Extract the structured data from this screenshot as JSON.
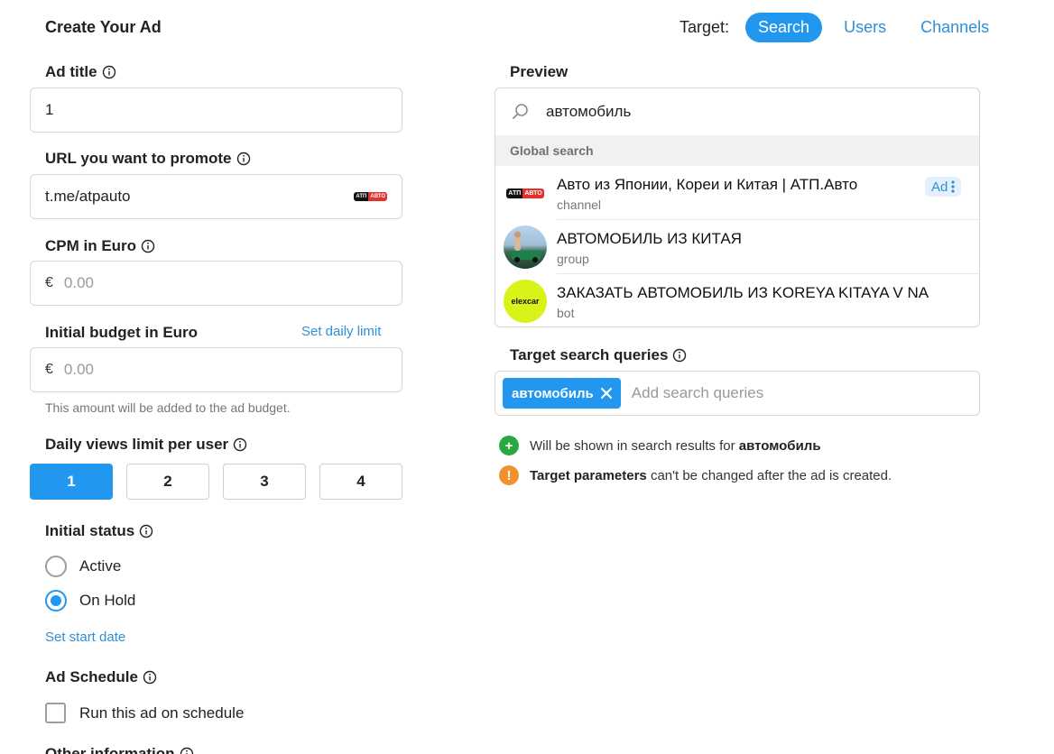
{
  "page": {
    "title": "Create Your Ad"
  },
  "target": {
    "label": "Target:",
    "tabs": [
      "Search",
      "Users",
      "Channels"
    ],
    "active": "Search"
  },
  "form": {
    "ad_title": {
      "label": "Ad title",
      "value": "1"
    },
    "url": {
      "label": "URL you want to promote",
      "value": "t.me/atpauto"
    },
    "cpm": {
      "label": "CPM in Euro",
      "prefix": "€",
      "placeholder": "0.00"
    },
    "budget": {
      "label": "Initial budget in Euro",
      "link": "Set daily limit",
      "prefix": "€",
      "placeholder": "0.00",
      "hint": "This amount will be added to the ad budget."
    },
    "views_limit": {
      "label": "Daily views limit per user",
      "options": [
        "1",
        "2",
        "3",
        "4"
      ],
      "selected": "1"
    },
    "status": {
      "label": "Initial status",
      "options": [
        "Active",
        "On Hold"
      ],
      "selected": "On Hold",
      "link": "Set start date"
    },
    "schedule": {
      "label": "Ad Schedule",
      "checkbox_label": "Run this ad on schedule",
      "checked": false
    },
    "other": {
      "label": "Other information"
    }
  },
  "preview": {
    "label": "Preview",
    "search_text": "автомобиль",
    "section": "Global search",
    "results": [
      {
        "title": "Авто из Японии, Кореи и Китая | АТП.Авто",
        "sub": "channel",
        "ad": "Ad"
      },
      {
        "title": "АВТОМОБИЛЬ ИЗ КИТАЯ",
        "sub": "group"
      },
      {
        "title": "ЗАКАЗАТЬ АВТОМОБИЛЬ ИЗ KOREYA KITAYA V NA",
        "sub": "bot",
        "avatar_text": "elexcar"
      }
    ],
    "avatar_brand": {
      "left": "АТП",
      "right": "АВТО"
    }
  },
  "queries": {
    "label": "Target search queries",
    "chip": "автомобиль",
    "placeholder": "Add search queries"
  },
  "notes": {
    "shown_prefix": "Will be shown in search results for",
    "shown_query": "автомобиль",
    "warn_bold": "Target parameters",
    "warn_rest": "can't be changed after the ad is created."
  },
  "colors": {
    "accent": "#2197f0",
    "link": "#2f8fd6",
    "success": "#2aa83f",
    "warning": "#f0922e",
    "elexcar": "#d9f31a"
  }
}
